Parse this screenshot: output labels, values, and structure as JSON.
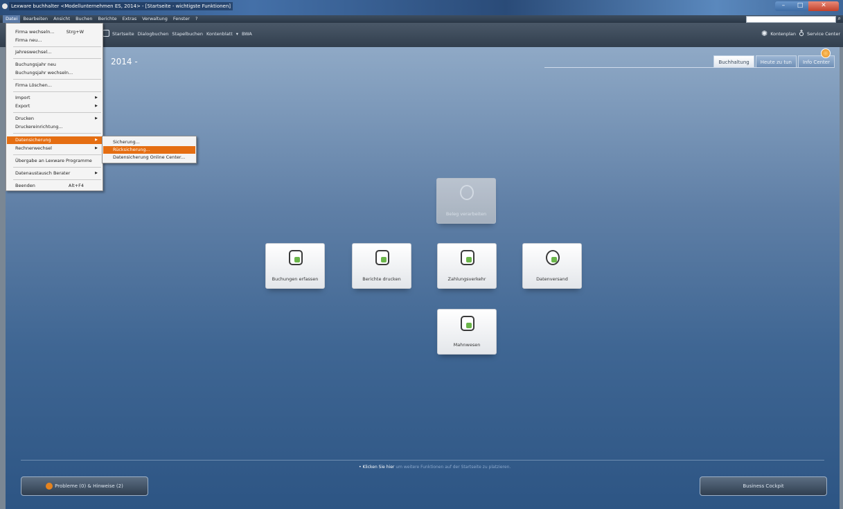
{
  "window": {
    "title": "Lexware buchhalter <Modellunternehmen ES, 2014> - [Startseite - wichtigste Funktionen]",
    "min_glyph": "–",
    "max_glyph": "□",
    "close_glyph": "✕"
  },
  "menubar": {
    "items": [
      "Datei",
      "Bearbeiten",
      "Ansicht",
      "Buchen",
      "Berichte",
      "Extras",
      "Verwaltung",
      "Fenster",
      "?"
    ]
  },
  "toolbar": {
    "nav": [
      "Startseite",
      "Dialogbuchen",
      "Stapelbuchen",
      "Kontenblatt",
      "▾",
      "BWA"
    ],
    "kontenplan": "Kontenplan",
    "service_center": "Service Center"
  },
  "main": {
    "year_title": "2014 -",
    "tabs": [
      "Buchhaltung",
      "Heute zu tun",
      "Info Center"
    ],
    "tiles": {
      "beleg": "Beleg verarbeiten",
      "buchungen": "Buchungen erfassen",
      "berichte": "Berichte drucken",
      "zahlung": "Zahlungsverkehr",
      "datenversand": "Datenversand",
      "mahnwesen": "Mahnwesen"
    },
    "hint_bold": "• Klicken Sie hier",
    "hint_rest": "um weitere Funktionen auf der Startseite zu platzieren.",
    "problems_button": "Probleme (0) & Hinweise (2)",
    "cockpit_button": "Business Cockpit"
  },
  "file_menu": {
    "items": [
      {
        "label": "Firma wechseln...",
        "shortcut": "Strg+W"
      },
      {
        "label": "Firma neu..."
      },
      {
        "label": "Jahreswechsel..."
      },
      {
        "label": "Buchungsjahr neu"
      },
      {
        "label": "Buchungsjahr wechseln..."
      },
      {
        "label": "Firma Löschen..."
      },
      {
        "label": "Import"
      },
      {
        "label": "Export"
      },
      {
        "label": "Drucken"
      },
      {
        "label": "Druckereinrichtung..."
      },
      {
        "label": "Datensicherung"
      },
      {
        "label": "Rechnerwechsel"
      },
      {
        "label": "Übergabe an Lexware Programme"
      },
      {
        "label": "Datenaustausch Berater"
      },
      {
        "label": "Beenden",
        "shortcut": "Alt+F4"
      }
    ]
  },
  "sub_menu": {
    "items": [
      "Sicherung...",
      "Rücksicherung...",
      "Datensicherung Online Center..."
    ]
  },
  "colors": {
    "highlight": "#e56e12",
    "accent_green": "#6bb64a"
  }
}
